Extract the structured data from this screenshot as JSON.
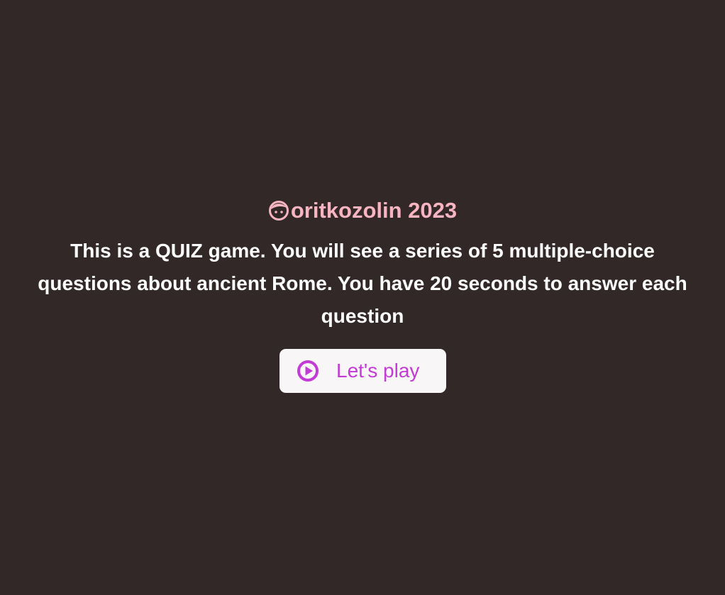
{
  "brand": {
    "icon": "kid-face-icon",
    "name": "oritkozolin 2023",
    "color": "#f8b4c0"
  },
  "intro": {
    "text": "This is a QUIZ game. You will see a series of 5 multiple-choice questions about ancient Rome. You have 20 seconds to answer each question"
  },
  "start_button": {
    "icon": "play-circle-icon",
    "label": "Let's play",
    "color": "#c43ad6"
  },
  "colors": {
    "background": "#322828",
    "text": "#ffffff",
    "button_bg": "#f8f6f7"
  }
}
